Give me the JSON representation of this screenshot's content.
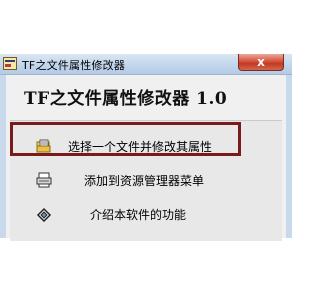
{
  "window": {
    "title": "TF之文件属性修改器",
    "close_symbol": "x",
    "app_icon": "tf-app-icon"
  },
  "heading": "TF之文件属性修改器 1.0",
  "menu": [
    {
      "label": "选择一个文件并修改其属性",
      "icon": "open-file-icon",
      "selected": true
    },
    {
      "label": "添加到资源管理器菜单",
      "icon": "menu-add-icon",
      "selected": false
    },
    {
      "label": "介绍本软件的功能",
      "icon": "info-icon",
      "selected": false
    }
  ],
  "colors": {
    "highlight_border": "#7a1a1a",
    "close_button": "#c23a22",
    "titlebar": "#c2d6ec"
  }
}
